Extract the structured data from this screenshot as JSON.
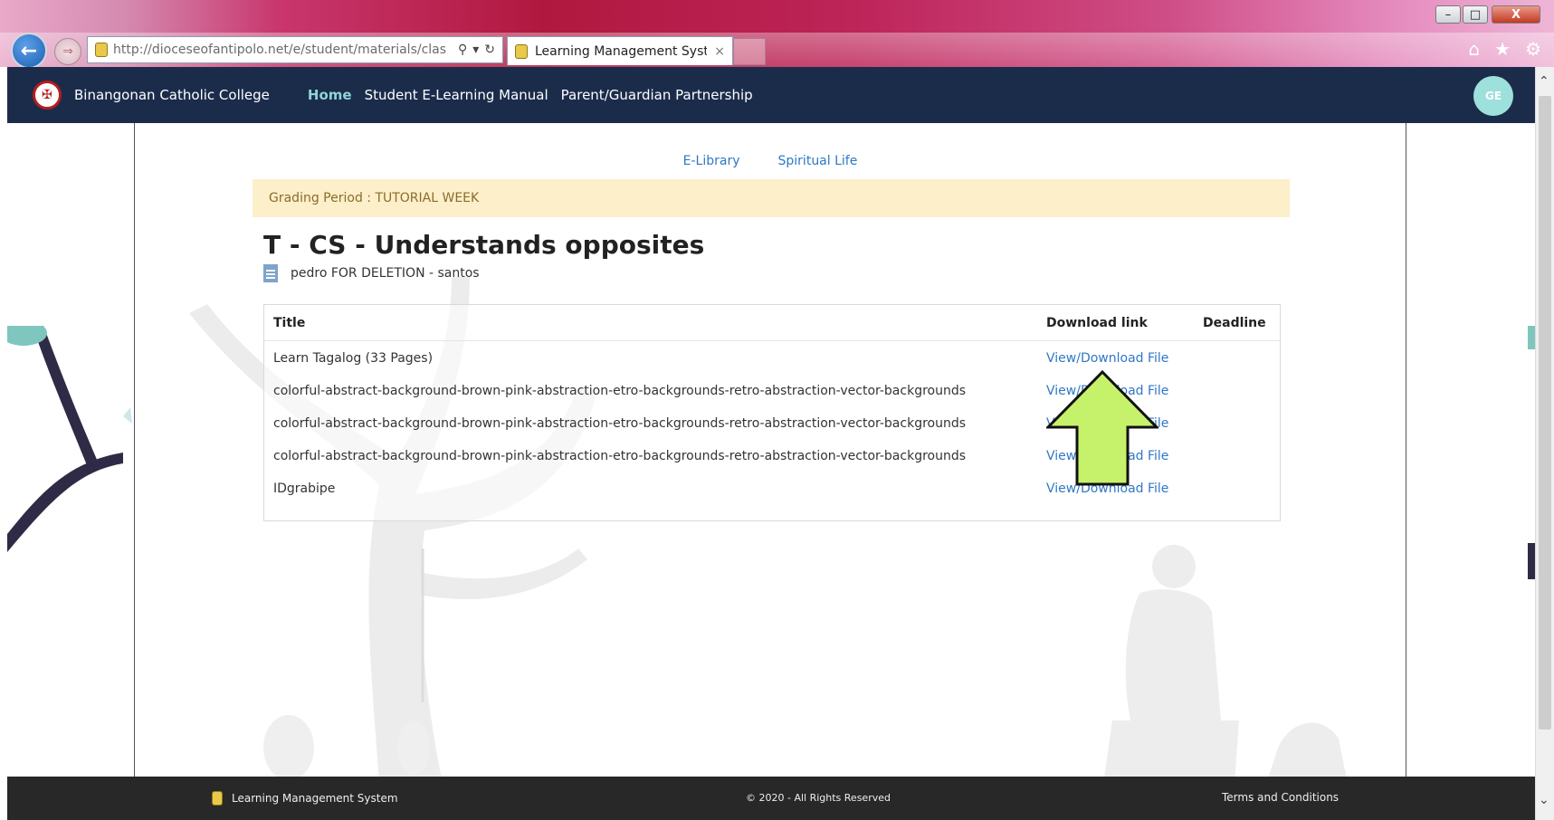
{
  "browser": {
    "url": "http://dioceseofantipolo.net/e/student/materials/clas",
    "tab_title": "Learning Management Syst...",
    "tab_close": "×",
    "window_min": "–",
    "window_max": "□",
    "window_close": "X",
    "icons": [
      "home-icon",
      "star-icon",
      "gear-icon"
    ]
  },
  "header": {
    "brand": "Binangonan Catholic College",
    "nav": [
      "Home",
      "Student E-Learning Manual",
      "Parent/Guardian Partnership"
    ],
    "avatar_initials": "GE"
  },
  "sublinks": [
    "E-Library",
    "Spiritual Life"
  ],
  "grading": "Grading Period : TUTORIAL WEEK",
  "title": "T - CS - Understands opposites",
  "author": "pedro FOR DELETION - santos",
  "table": {
    "headers": {
      "title": "Title",
      "link": "Download link",
      "deadline": "Deadline"
    },
    "rows": [
      {
        "title": "Learn Tagalog (33 Pages)",
        "link": "View/Download File",
        "deadline": ""
      },
      {
        "title": "colorful-abstract-background-brown-pink-abstraction-etro-backgrounds-retro-abstraction-vector-backgrounds",
        "link": "View/Download File",
        "deadline": ""
      },
      {
        "title": "colorful-abstract-background-brown-pink-abstraction-etro-backgrounds-retro-abstraction-vector-backgrounds",
        "link": "View/Download File",
        "deadline": ""
      },
      {
        "title": "colorful-abstract-background-brown-pink-abstraction-etro-backgrounds-retro-abstraction-vector-backgrounds",
        "link": "View/Download File",
        "deadline": ""
      },
      {
        "title": "IDgrabipe",
        "link": "View/Download File",
        "deadline": ""
      }
    ]
  },
  "footer": {
    "app_name": "Learning Management System",
    "copyright": "© 2020 - All Rights Reserved",
    "terms": "Terms and Conditions"
  },
  "colors": {
    "header_bg": "#1b2c4b",
    "link": "#2f78c4",
    "grading_bg": "#fcefc9",
    "footer_bg": "#282828",
    "annotation_arrow": "#c6f26b"
  }
}
